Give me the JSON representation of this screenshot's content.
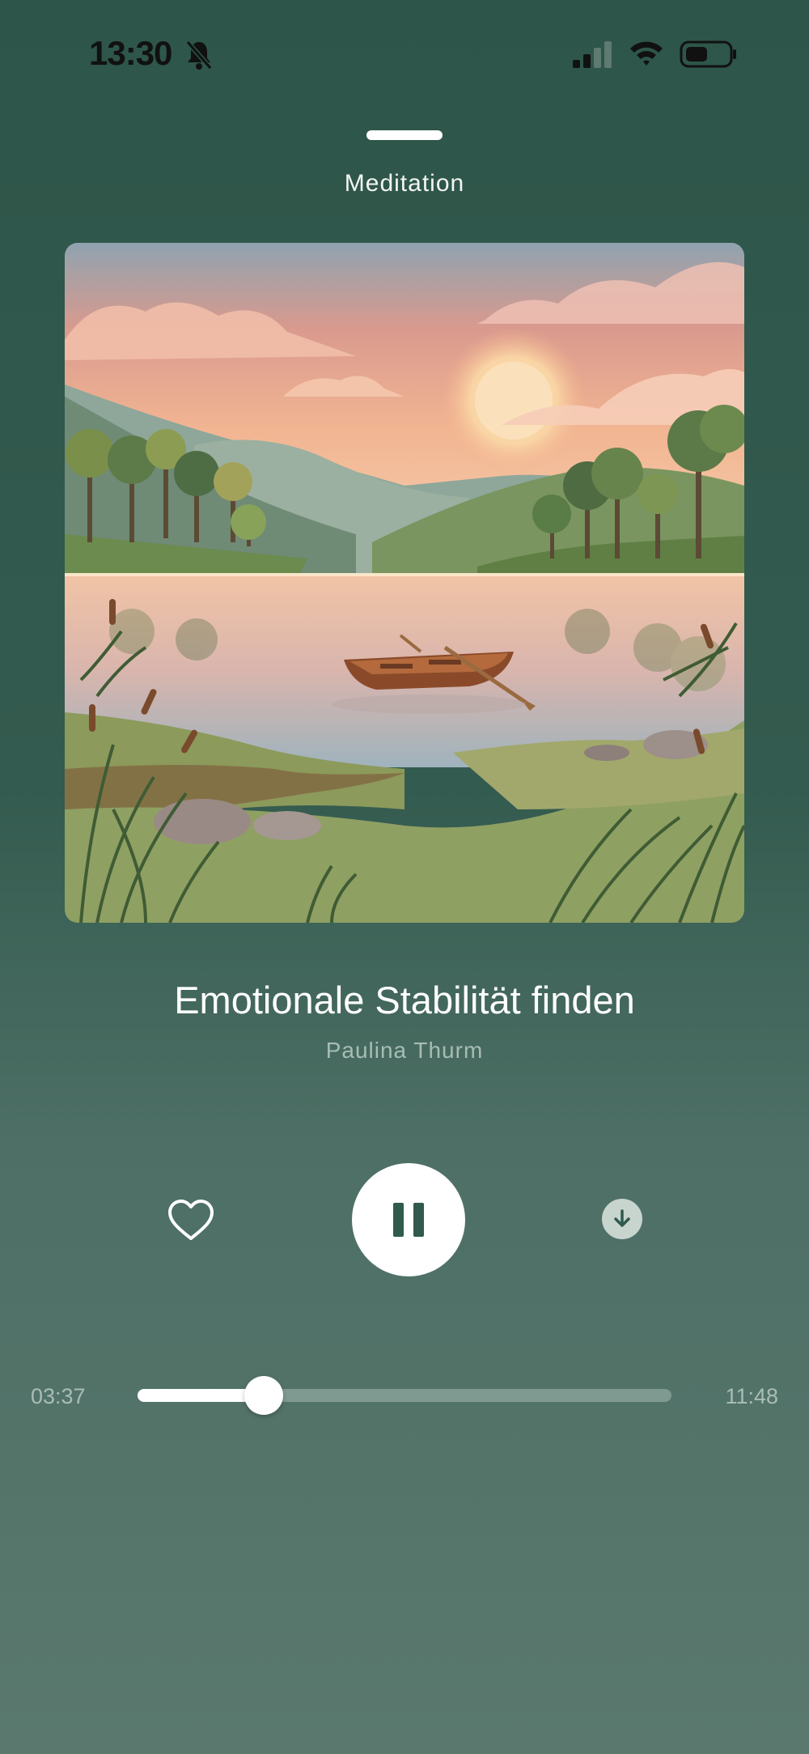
{
  "status_bar": {
    "time": "13:30",
    "icons": [
      "bell-slash-icon",
      "cellular-signal-icon",
      "wifi-icon",
      "battery-icon"
    ]
  },
  "header": {
    "title": "Meditation"
  },
  "artwork": {
    "description_icon": "lake-sunset-artwork"
  },
  "track": {
    "title": "Emotionale Stabilität finden",
    "artist": "Paulina Thurm"
  },
  "controls": {
    "like_icon": "heart-outline-icon",
    "play_state_icon": "pause-icon",
    "download_icon": "download-icon"
  },
  "playback": {
    "current_time": "03:37",
    "total_time": "11:48",
    "progress": 0.237
  },
  "colors": {
    "background": "#2e5549",
    "accent": "#ffffff",
    "muted_text": "#a9bdb5"
  }
}
